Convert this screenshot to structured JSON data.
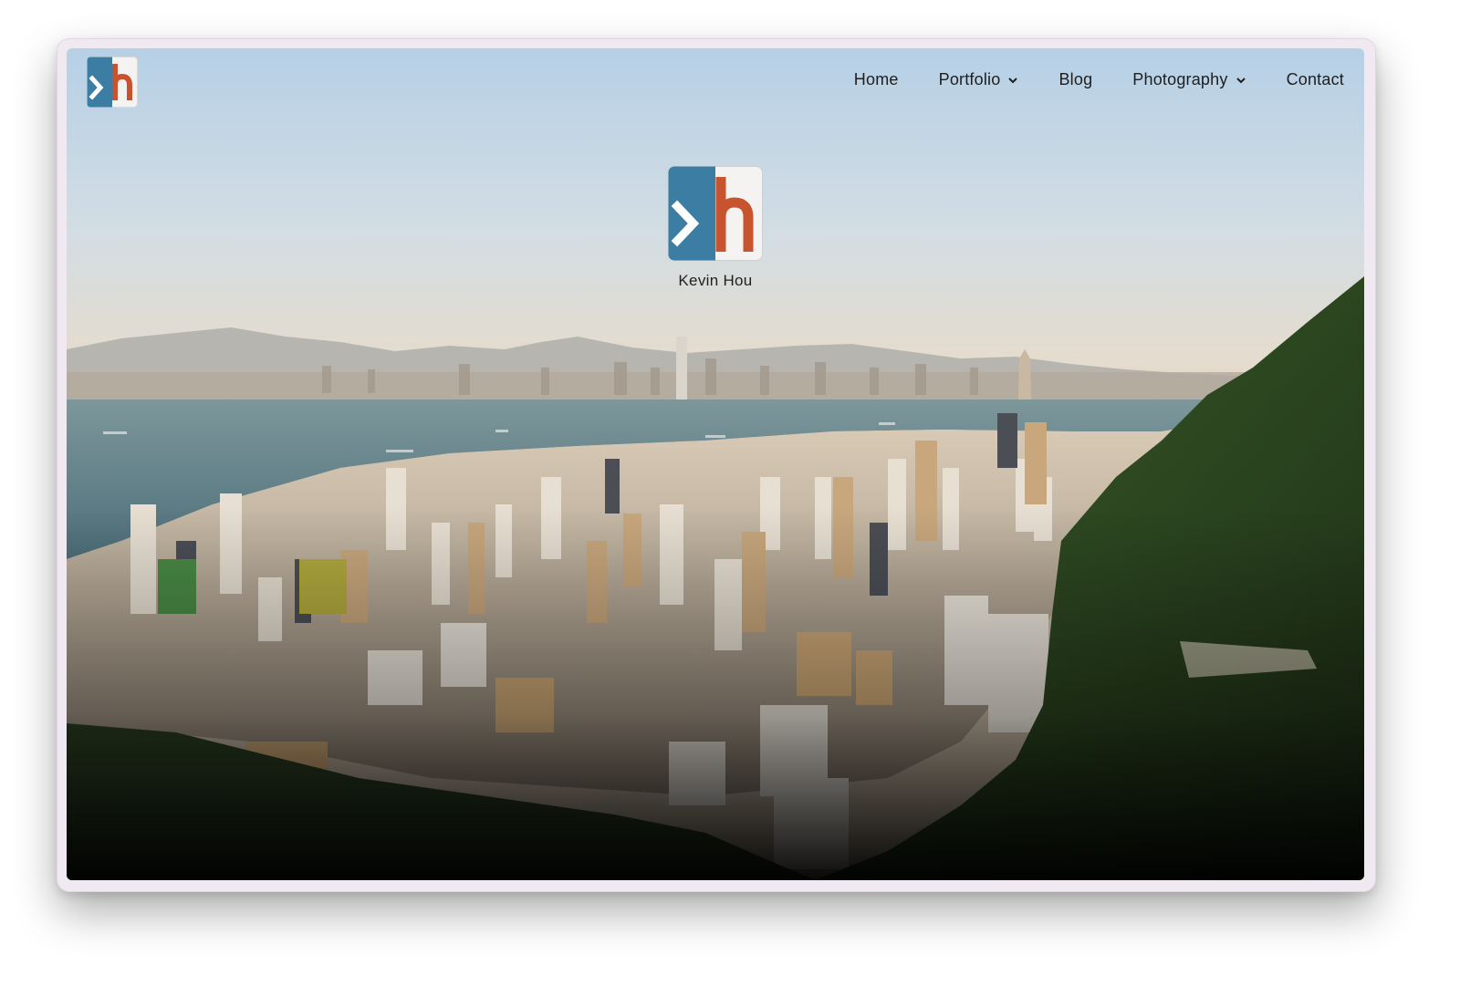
{
  "site": {
    "name": "Kevin Hou",
    "logo": {
      "left_color": "#3c7ea3",
      "right_color": "#c8532f",
      "right_bg": "#f5f3f2",
      "icon": "kh-logo-icon"
    }
  },
  "nav": {
    "items": [
      {
        "label": "Home",
        "has_dropdown": false
      },
      {
        "label": "Portfolio",
        "has_dropdown": true
      },
      {
        "label": "Blog",
        "has_dropdown": false
      },
      {
        "label": "Photography",
        "has_dropdown": true
      },
      {
        "label": "Contact",
        "has_dropdown": false
      }
    ]
  },
  "hero": {
    "scene": "hong-kong-skyline-image",
    "colors": {
      "sky_top": "#b9d2e6",
      "haze": "#e4dccd",
      "water": "#5b7f88",
      "hill": "#2e4a22"
    }
  }
}
